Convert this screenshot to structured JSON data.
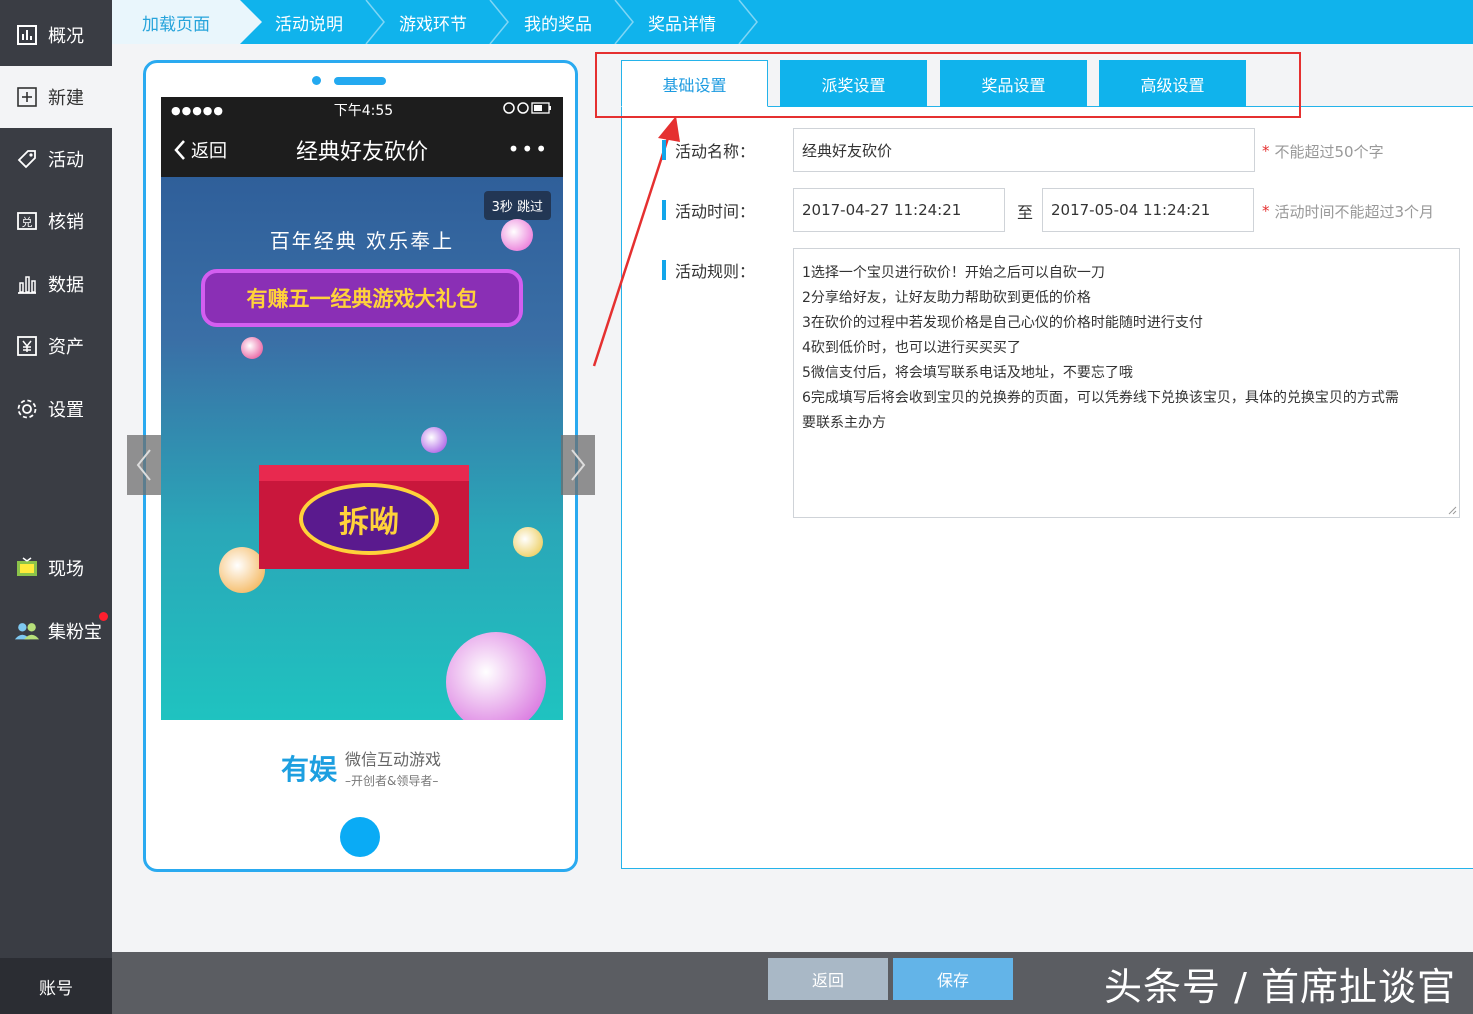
{
  "sidebar": {
    "items": [
      {
        "label": "概况",
        "icon": "chart-icon"
      },
      {
        "label": "新建",
        "icon": "plus-icon"
      },
      {
        "label": "活动",
        "icon": "tag-icon"
      },
      {
        "label": "核销",
        "icon": "redeem-icon"
      },
      {
        "label": "数据",
        "icon": "bar-chart-icon"
      },
      {
        "label": "资产",
        "icon": "yen-icon"
      },
      {
        "label": "设置",
        "icon": "gear-icon"
      },
      {
        "label": "现场",
        "icon": "screen-icon"
      },
      {
        "label": "集粉宝",
        "icon": "users-icon"
      }
    ],
    "account": "账号"
  },
  "steps": [
    "加载页面",
    "活动说明",
    "游戏环节",
    "我的奖品",
    "奖品详情"
  ],
  "phone": {
    "status_left": "●●●●●",
    "time": "下午4:55",
    "back": "返回",
    "title": "经典好友砍价",
    "more": "•••",
    "skip": "3秒 跳过",
    "slogan": "百年经典  欢乐奉上",
    "banner": "有赚五一经典游戏大礼包",
    "open_button": "拆呦",
    "logo_mark": "有娱",
    "logo_line1": "微信互动游戏",
    "logo_line2": "–开创者&领导者–"
  },
  "tabs": [
    "基础设置",
    "派奖设置",
    "奖品设置",
    "高级设置"
  ],
  "form": {
    "name_label": "活动名称：",
    "name_value": "经典好友砍价",
    "name_hint": "不能超过50个字",
    "time_label": "活动时间：",
    "start_time": "2017-04-27 11:24:21",
    "to": "至",
    "end_time": "2017-05-04 11:24:21",
    "time_hint": "活动时间不能超过3个月",
    "rules_label": "活动规则：",
    "rules": [
      "1选择一个宝贝进行砍价！开始之后可以自砍一刀",
      "2分享给好友，让好友助力帮助砍到更低的价格",
      "3在砍价的过程中若发现价格是自己心仪的价格时能随时进行支付",
      "4砍到低价时，也可以进行买买买了",
      "5微信支付后，将会填写联系电话及地址，不要忘了哦",
      "6完成填写后将会收到宝贝的兑换券的页面，可以凭券线下兑换该宝贝，具体的兑换宝贝的方式需",
      "要联系主办方"
    ]
  },
  "footer": {
    "back": "返回",
    "save": "保存",
    "watermark": "头条号 / 首席扯谈官"
  }
}
